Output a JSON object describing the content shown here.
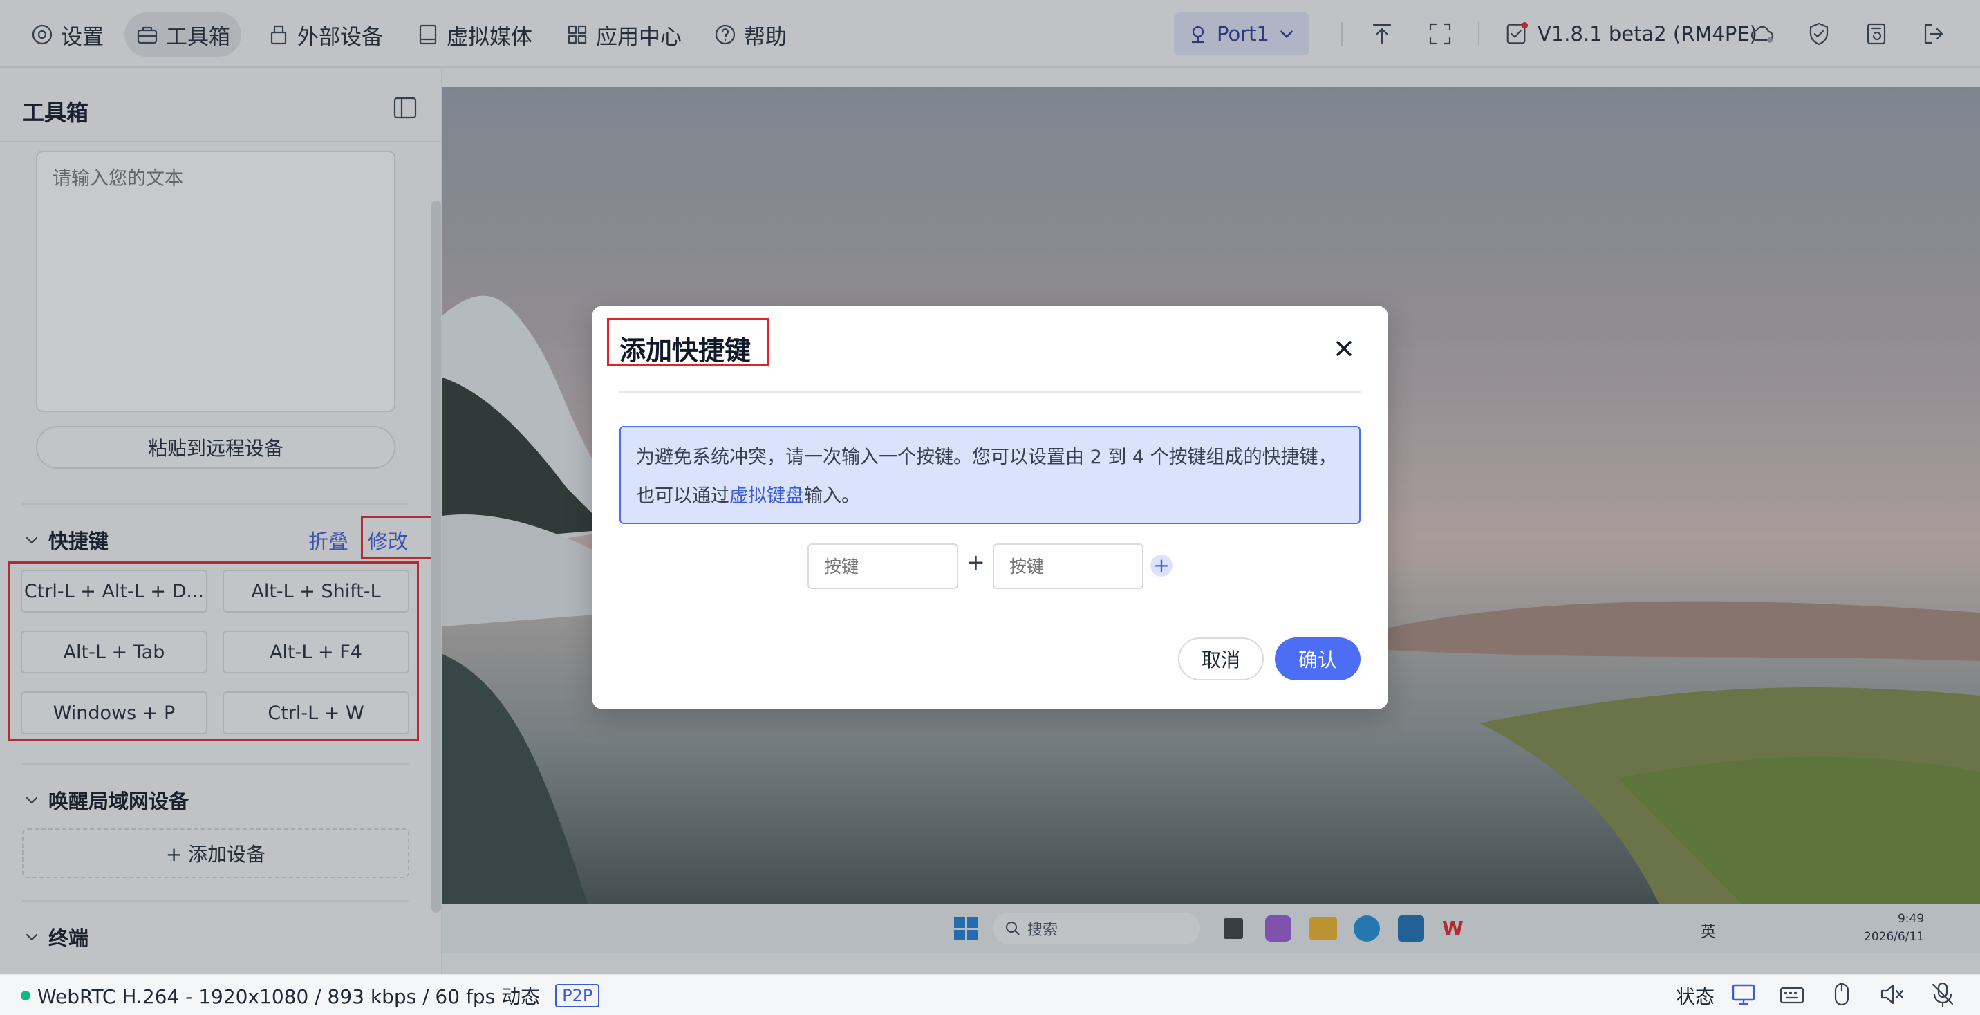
{
  "nav": {
    "settings": "设置",
    "toolbox": "工具箱",
    "external_devices": "外部设备",
    "virtual_media": "虚拟媒体",
    "app_center": "应用中心",
    "help": "帮助"
  },
  "port": {
    "label": "Port1"
  },
  "version": {
    "label": "V1.8.1 beta2 (RM4PE)"
  },
  "sidebar": {
    "title": "工具箱",
    "text_placeholder": "请输入您的文本",
    "paste_label": "粘贴到远程设备",
    "shortcuts": {
      "title": "快捷键",
      "fold": "折叠",
      "edit": "修改",
      "items": [
        "Ctrl-L + Alt-L + D...",
        "Alt-L + Shift-L",
        "Alt-L + Tab",
        "Alt-L + F4",
        "Windows + P",
        "Ctrl-L + W"
      ]
    },
    "wol": {
      "title": "唤醒局域网设备",
      "add_device": "+ 添加设备"
    },
    "terminal": {
      "title": "终端"
    }
  },
  "remote_taskbar": {
    "search": "搜索",
    "ime": "英",
    "time": "9:49",
    "date": "2026/6/11"
  },
  "status": {
    "stream": "WebRTC H.264 - 1920x1080 /  893 kbps / 60 fps 动态",
    "p2p": "P2P",
    "state_label": "状态"
  },
  "modal": {
    "title": "添加快捷键",
    "alert_text": "为避免系统冲突，请一次输入一个按键。您可以设置由 2 到 4 个按键组成的快捷键，也可以通过",
    "alert_link": "虚拟键盘",
    "alert_suffix": "输入。",
    "key_placeholder": "按键",
    "plus": "+",
    "add_key": "+",
    "cancel": "取消",
    "confirm": "确认"
  },
  "colors": {
    "accent": "#4c6ef5",
    "highlight_box": "#e0242b",
    "alert_bg": "#dbe2fb"
  }
}
